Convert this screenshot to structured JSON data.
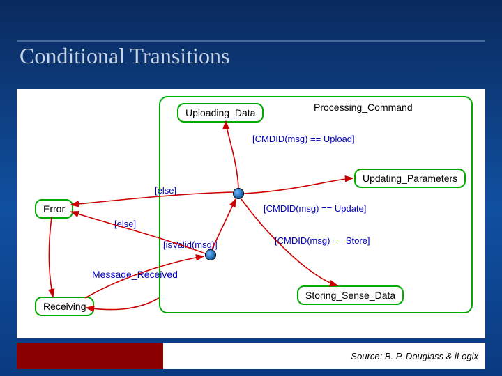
{
  "slide": {
    "title": "Conditional Transitions",
    "source": "Source: B. P. Douglass & iLogix"
  },
  "states": {
    "uploading": "Uploading_Data",
    "processing": "Processing_Command",
    "updating": "Updating_Parameters",
    "storing": "Storing_Sense_Data",
    "error": "Error",
    "receiving": "Receiving",
    "message_received": "Message_Received"
  },
  "guards": {
    "upload": "[CMDID(msg) == Upload]",
    "update": "[CMDID(msg) == Update]",
    "store": "[CMDID(msg) == Store]",
    "isvalid": "[isValid(msg)]",
    "else1": "[else]",
    "else2": "[else]"
  }
}
